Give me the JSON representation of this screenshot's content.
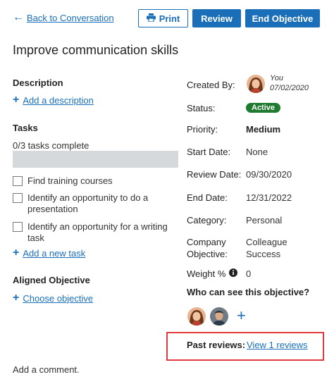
{
  "nav": {
    "back_label": "Back to Conversation"
  },
  "toolbar": {
    "print_label": "Print",
    "review_label": "Review",
    "end_label": "End Objective"
  },
  "objective": {
    "title": "Improve communication skills"
  },
  "description": {
    "heading": "Description",
    "add_label": "Add a description"
  },
  "tasks": {
    "heading": "Tasks",
    "progress_text": "0/3 tasks complete",
    "progress_fraction": 0,
    "items": [
      {
        "label": "Find training courses",
        "checked": false
      },
      {
        "label": "Identify an opportunity to do a presentation",
        "checked": false
      },
      {
        "label": "Identify an opportunity for a writing task",
        "checked": false
      }
    ],
    "add_label": "Add a new task"
  },
  "aligned": {
    "heading": "Aligned Objective",
    "choose_label": "Choose objective"
  },
  "details": {
    "created_by_label": "Created By:",
    "created_by_name": "You",
    "created_date": "07/02/2020",
    "status_label": "Status:",
    "status_value": "Active",
    "priority_label": "Priority:",
    "priority_value": "Medium",
    "start_label": "Start Date:",
    "start_value": "None",
    "review_label": "Review Date:",
    "review_value": "09/30/2020",
    "end_label": "End Date:",
    "end_value": "12/31/2022",
    "category_label": "Category:",
    "category_value": "Personal",
    "company_label_1": "Company",
    "company_label_2": "Objective:",
    "company_value_1": "Colleague",
    "company_value_2": "Success",
    "weight_label": "Weight %",
    "weight_value": "0",
    "visibility_label": "Who can see this objective?"
  },
  "reviews": {
    "label": "Past reviews:",
    "link": "View 1 reviews"
  },
  "comment": {
    "label": "Add a comment."
  },
  "colors": {
    "accent": "#1a6fb8",
    "active": "#1e7b2f",
    "highlight": "#e0393e"
  }
}
